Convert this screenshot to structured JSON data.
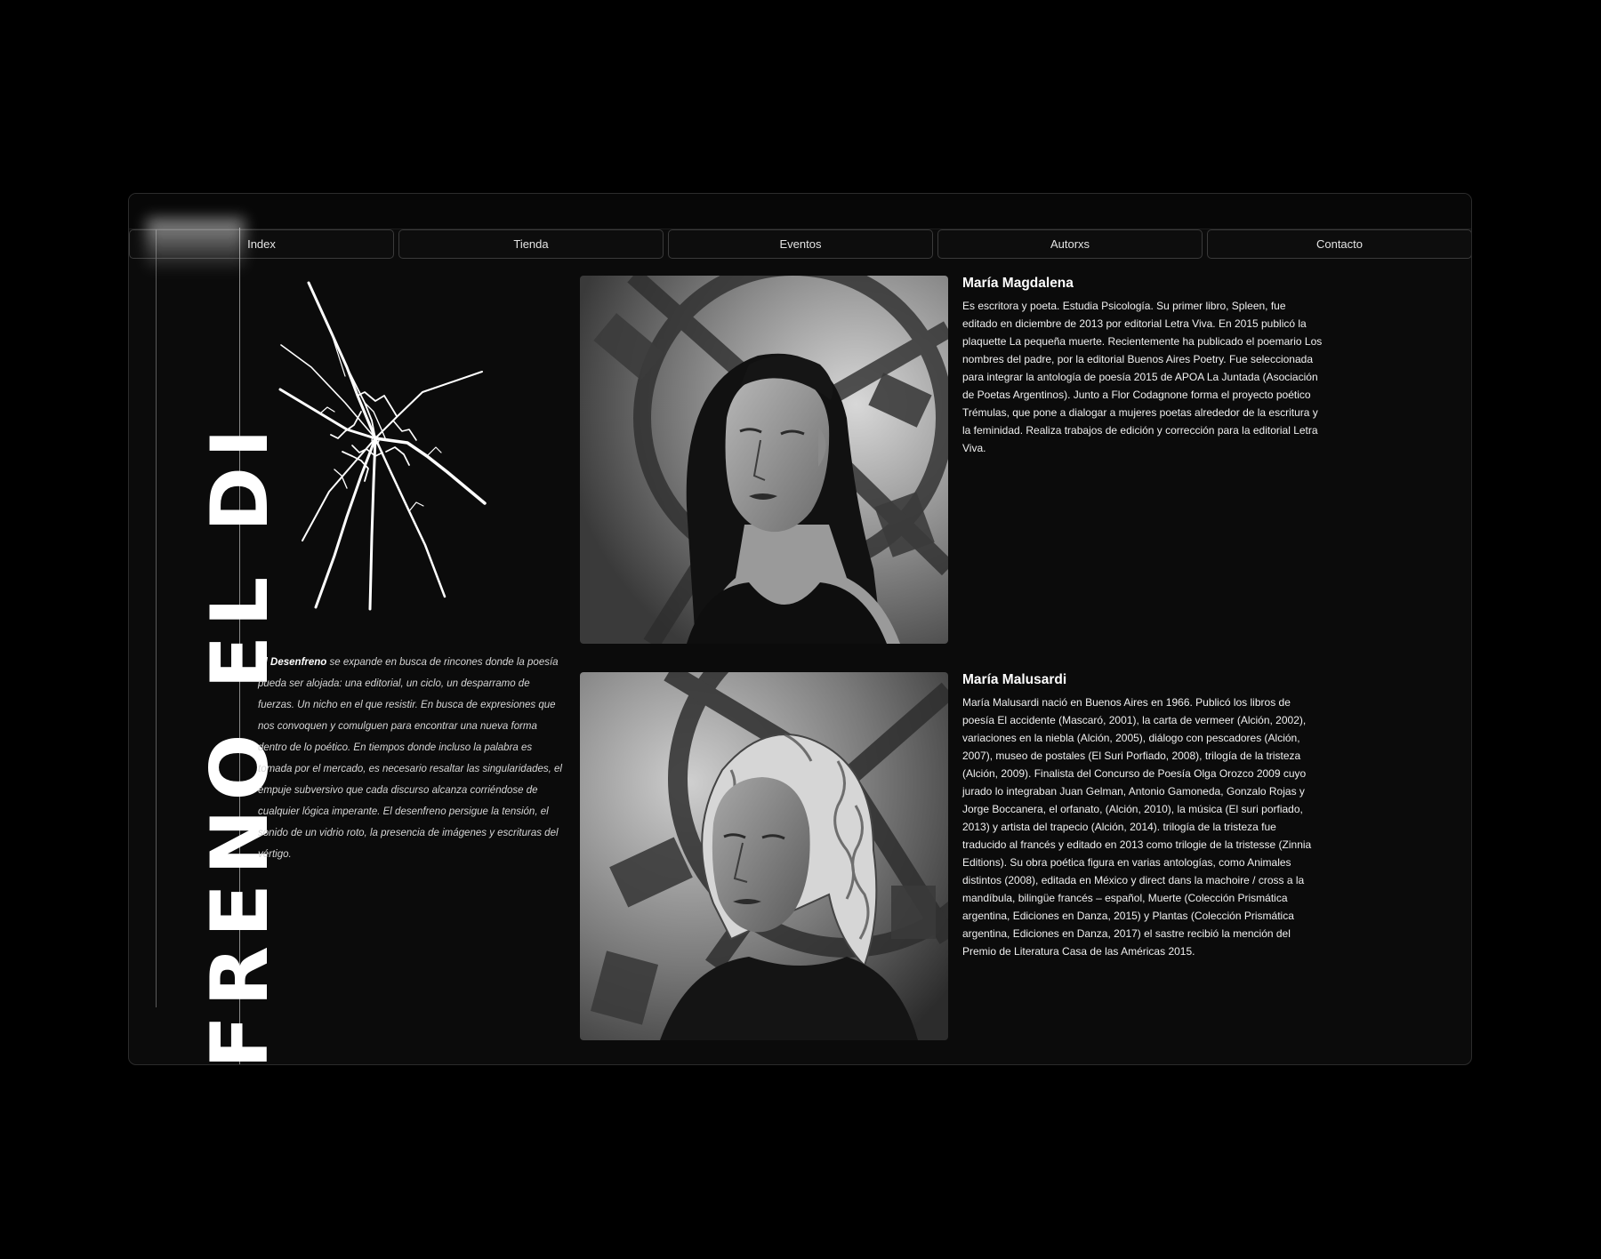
{
  "nav": {
    "items": [
      {
        "label": "Index"
      },
      {
        "label": "Tienda"
      },
      {
        "label": "Eventos"
      },
      {
        "label": "Autorxs"
      },
      {
        "label": "Contacto"
      }
    ]
  },
  "sidebar": {
    "vertical_title": "FRENO EL DI"
  },
  "intro": {
    "emphasis": "El Desenfreno",
    "text": " se expande en busca de rincones donde la poesía pueda ser alojada: una editorial, un ciclo, un desparramo de fuerzas. Un nicho en el que resistir. En busca de expresiones que nos convoquen y comulguen para encontrar una nueva forma dentro de lo poético. En tiempos donde incluso la palabra es tomada por el mercado, es necesario resaltar las singularidades, el empuje subversivo que cada discurso alcanza corriéndose de cualquier lógica imperante. El desenfreno persigue la tensión, el sonido de un vidrio roto, la presencia de imágenes y escrituras del vértigo."
  },
  "authors": [
    {
      "name": "María Magdalena",
      "bio": "Es escritora y poeta. Estudia Psicología. Su primer libro, Spleen, fue editado en diciembre de 2013 por editorial Letra Viva. En 2015 publicó la plaquette La pequeña muerte. Recientemente ha publicado el poemario Los nombres del padre, por la editorial Buenos Aires Poetry. Fue seleccionada para integrar la antología de poesía 2015 de APOA La Juntada (Asociación de Poetas Argentinos). Junto a Flor Codagnone forma el proyecto poético Trémulas, que pone a dialogar a mujeres poetas alrededor de la escritura y la feminidad. Realiza trabajos de edición y corrección para la editorial Letra Viva."
    },
    {
      "name": "María Malusardi",
      "bio": "María Malusardi nació en Buenos Aires en 1966. Publicó los libros de poesía El accidente (Mascaró, 2001), la carta de vermeer (Alción, 2002), variaciones en la niebla (Alción, 2005), diálogo con pescadores (Alción, 2007), museo de postales (El Suri Porfiado, 2008), trilogía de la tristeza (Alción, 2009). Finalista del Concurso de Poesía Olga Orozco 2009 cuyo jurado lo integraban Juan Gelman, Antonio Gamoneda, Gonzalo Rojas y Jorge Boccanera, el orfanato, (Alción, 2010), la música (El suri porfiado, 2013) y artista del trapecio (Alción, 2014). trilogía de la tristeza fue traducido al francés y editado en 2013 como trilogie de la tristesse (Zinnia Editions). Su obra poética figura en varias antologías, como Animales distintos (2008), editada en México y direct dans la machoire / cross a la mandíbula, bilingüe francés – español, Muerte (Colección Prismática argentina, Ediciones en Danza, 2015) y Plantas (Colección Prismática argentina, Ediciones en Danza, 2017) el sastre recibió la mención del Premio de Literatura Casa de las Américas 2015."
    }
  ]
}
